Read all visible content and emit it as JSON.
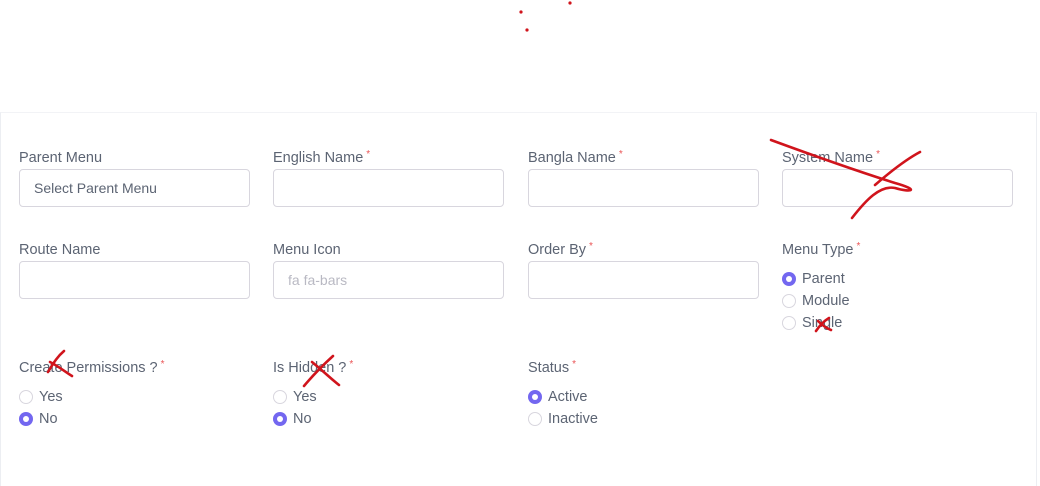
{
  "form": {
    "parent_menu": {
      "label": "Parent Menu",
      "value": "Select Parent Menu"
    },
    "english_name": {
      "label": "English Name",
      "required": "*",
      "value": ""
    },
    "bangla_name": {
      "label": "Bangla Name",
      "required": "*",
      "value": ""
    },
    "system_name": {
      "label": "System Name",
      "required": "*",
      "value": ""
    },
    "route_name": {
      "label": "Route Name",
      "value": ""
    },
    "menu_icon": {
      "label": "Menu Icon",
      "placeholder": "fa fa-bars"
    },
    "order_by": {
      "label": "Order By",
      "required": "*",
      "value": ""
    },
    "menu_type": {
      "label": "Menu Type",
      "required": "*",
      "options": [
        {
          "label": "Parent",
          "checked": true
        },
        {
          "label": "Module",
          "checked": false
        },
        {
          "label": "Single",
          "checked": false
        }
      ]
    },
    "create_permissions": {
      "label": "Create Permissions ?",
      "required": "*",
      "options": [
        {
          "label": "Yes",
          "checked": false
        },
        {
          "label": "No",
          "checked": true
        }
      ]
    },
    "is_hidden": {
      "label": "Is Hidden ?",
      "required": "*",
      "options": [
        {
          "label": "Yes",
          "checked": false
        },
        {
          "label": "No",
          "checked": true
        }
      ]
    },
    "status": {
      "label": "Status",
      "required": "*",
      "options": [
        {
          "label": "Active",
          "checked": true
        },
        {
          "label": "Inactive",
          "checked": false
        }
      ]
    }
  },
  "colors": {
    "accent": "#7367f0",
    "required": "#ea5455",
    "annotation": "#d0141c"
  }
}
